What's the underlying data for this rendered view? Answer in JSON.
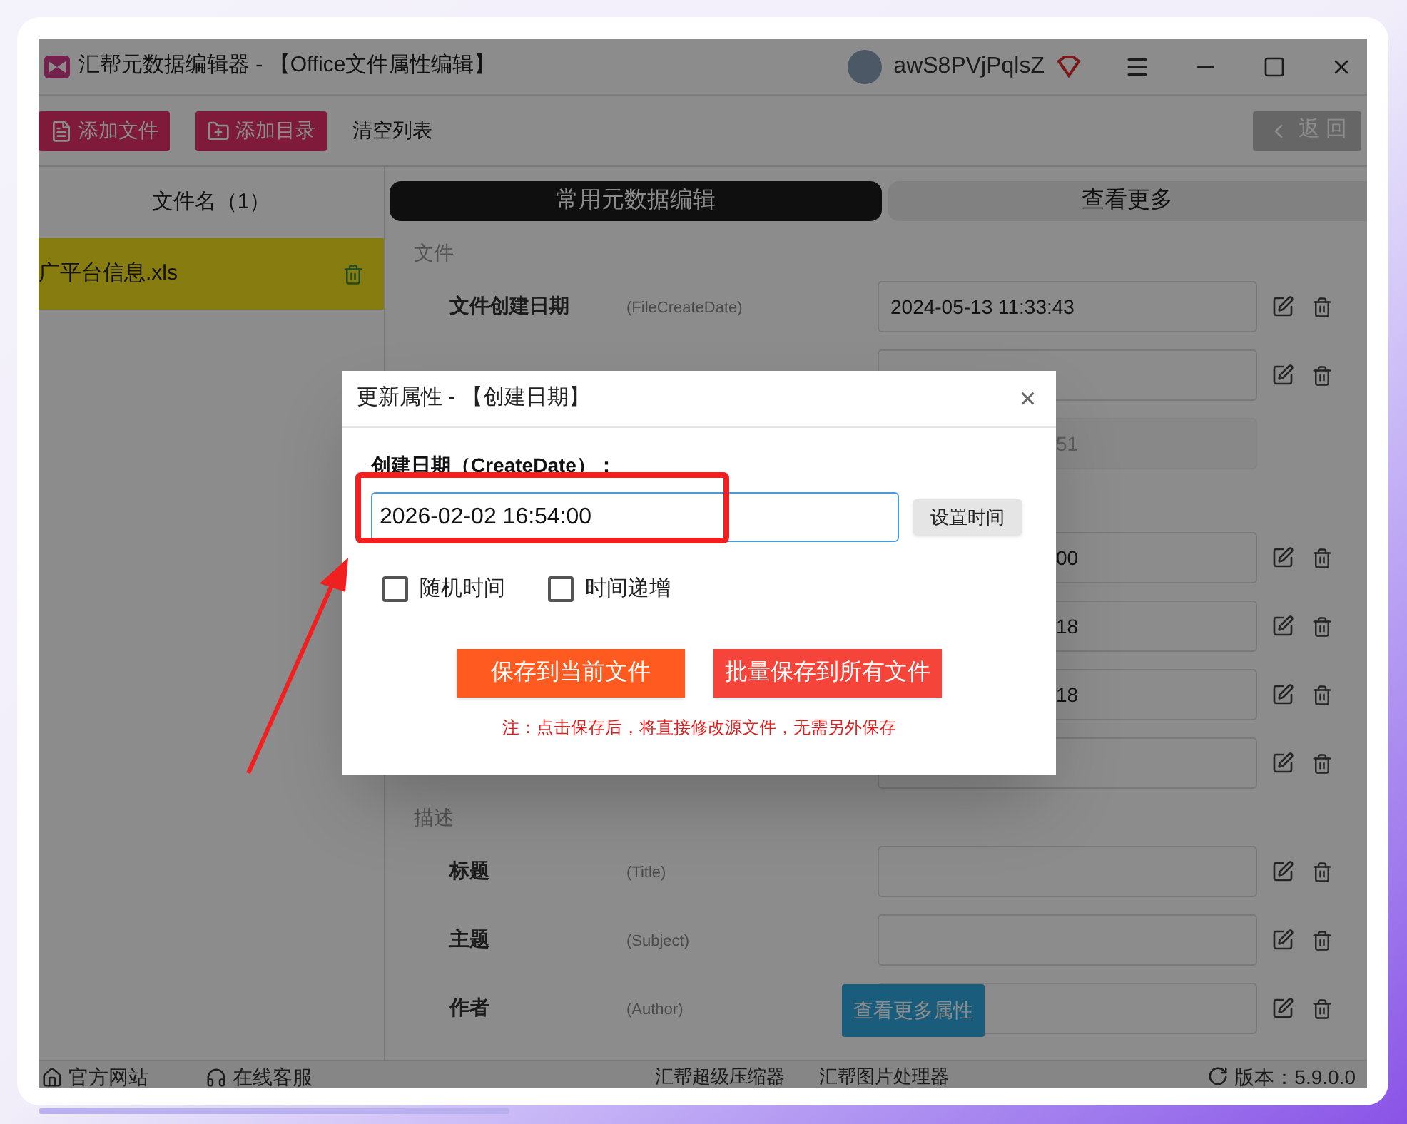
{
  "window": {
    "title": "汇帮元数据编辑器 - 【Office文件属性编辑】",
    "username": "awS8PVjPqlsZ"
  },
  "toolbar": {
    "buttons": [
      {
        "label": "添加文件",
        "kind": "file"
      },
      {
        "label": "添加目录",
        "kind": "folder"
      }
    ],
    "link": "清空列表",
    "back": "返 回"
  },
  "file_list": {
    "header": "文件名（1）",
    "files": [
      {
        "name": "广平台信息.xls",
        "selected": true
      }
    ]
  },
  "tabs": [
    {
      "label": "常用元数据编辑",
      "selected": true
    },
    {
      "label": "查看更多",
      "selected": false
    }
  ],
  "sections": [
    {
      "title": "文件",
      "rows": [
        {
          "kind": "editable",
          "label": "文件创建日期",
          "hint": "(FileCreateDate)",
          "value": "2024-05-13 11:33:43"
        },
        {
          "kind": "covered",
          "value": ""
        },
        {
          "kind": "covered_readonly",
          "value": "51"
        }
      ]
    },
    {
      "rows": [
        {
          "kind": "covered",
          "value": "00"
        },
        {
          "kind": "covered",
          "value": "18"
        },
        {
          "kind": "covered",
          "value": "18"
        },
        {
          "kind": "covered",
          "value": ""
        }
      ]
    },
    {
      "title": "描述",
      "rows": [
        {
          "kind": "editable",
          "label": "标题",
          "hint": "(Title)",
          "value": ""
        },
        {
          "kind": "editable",
          "label": "主题",
          "hint": "(Subject)",
          "value": ""
        },
        {
          "kind": "editable",
          "label": "作者",
          "hint": "(Author)",
          "value": ""
        }
      ]
    }
  ],
  "more_button": "查看更多属性",
  "status_bar": {
    "links": [
      {
        "label": "官方网站",
        "kind": "home"
      },
      {
        "label": "在线客服",
        "kind": "support"
      }
    ],
    "products": [
      "汇帮超级压缩器",
      "汇帮图片处理器"
    ],
    "version": "版本：5.9.0.0"
  },
  "dialog": {
    "title": "更新属性 - 【创建日期】",
    "close": "×",
    "field_label": "创建日期（CreateDate）：",
    "value": "2026-02-02 16:54:00",
    "set_time": "设置时间",
    "options": [
      {
        "label": "随机时间",
        "checked": false
      },
      {
        "label": "时间递增",
        "checked": false
      }
    ],
    "buttons": [
      {
        "label": "保存到当前文件",
        "kind": "current"
      },
      {
        "label": "批量保存到所有文件",
        "kind": "all"
      }
    ],
    "note": "注：点击保存后，将直接修改源文件，无需另外保存"
  }
}
